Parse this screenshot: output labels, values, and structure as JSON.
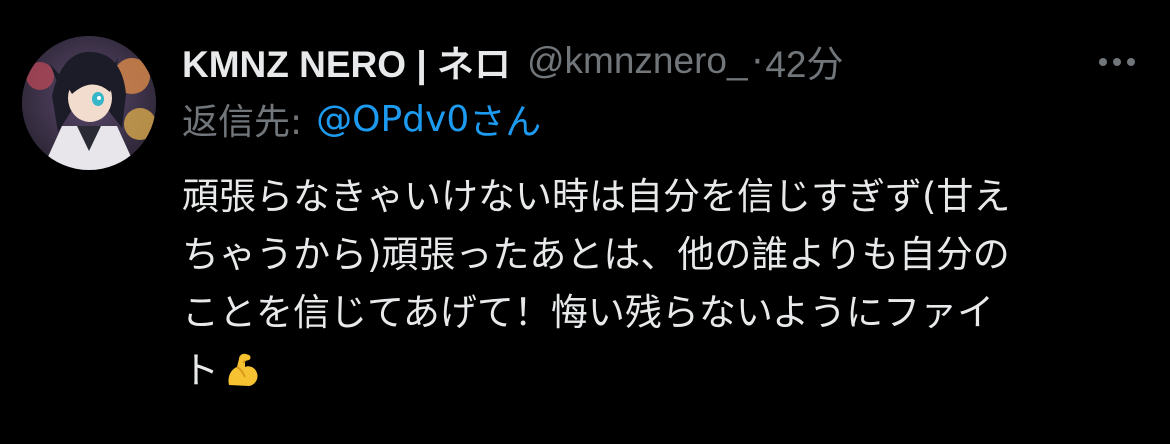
{
  "tweet": {
    "display_name": "KMNZ NERO | ネロ",
    "handle": "@kmnznero_",
    "separator": "·",
    "time": "42分",
    "reply_prefix": "返信先:",
    "reply_mention": "@OPdv0",
    "reply_suffix": "さん",
    "body_lines": [
      "頑張らなきゃいけない時は自分を信じすぎず(甘え",
      "ちゃうから)頑張ったあとは、他の誰よりも自分の",
      "ことを信じてあげて！悔い残らないようにファイ",
      "ト"
    ],
    "body_emoji": "flexed-biceps-icon"
  },
  "colors": {
    "background": "#000000",
    "primary_text": "#e7e9ea",
    "secondary_text": "#71767b",
    "link": "#1d9bf0"
  }
}
